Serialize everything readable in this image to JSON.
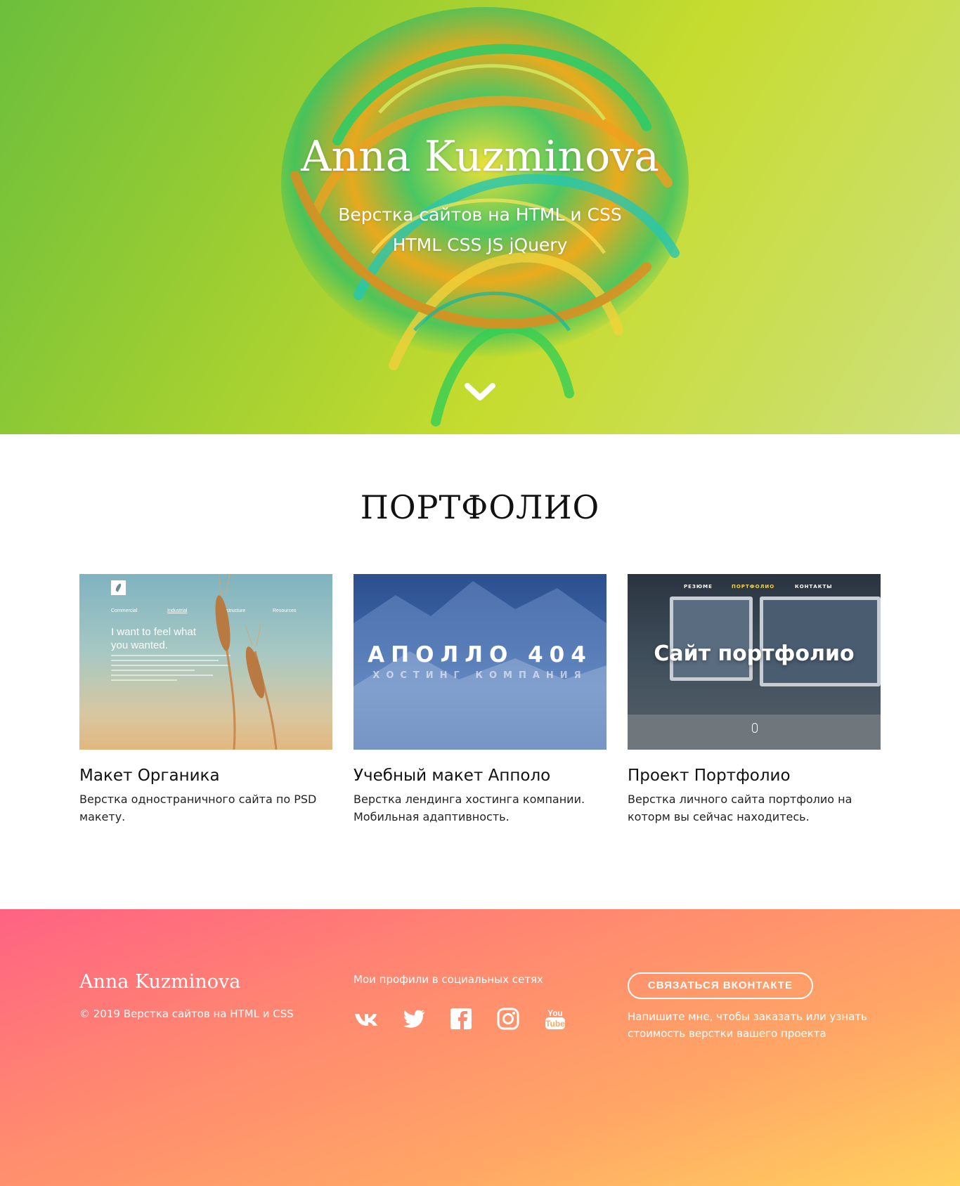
{
  "hero": {
    "title": "Anna Kuzminova",
    "subtitle_line1": "Верстка сайтов на HTML и CSS",
    "subtitle_line2": "HTML CSS JS jQuery",
    "scroll_icon": "chevron-down-icon"
  },
  "portfolio": {
    "heading": "ПОРТФОЛИО",
    "cards": [
      {
        "title": "Макет Органика",
        "description": "Верстка одностраничного сайта по PSD макету.",
        "thumb": {
          "nav": [
            "Commercial",
            "Industrial",
            "Infrastructure",
            "Resources"
          ],
          "tagline": "I want to feel what you wanted."
        }
      },
      {
        "title": "Учебный макет Апполо",
        "description": "Верстка лендинга хостинга компании. Мобильная адаптивность.",
        "thumb": {
          "headline": "АПОЛЛО 404",
          "subline": "ХОСТИНГ КОМПАНИЯ"
        }
      },
      {
        "title": "Проект Портфолио",
        "description": "Верстка личного сайта портфолио на которм вы сейчас находитесь.",
        "thumb": {
          "nav": [
            "РЕЗЮМЕ",
            "ПОРТФОЛИО",
            "КОНТАКТЫ"
          ],
          "headline": "Сайт портфолио"
        }
      }
    ]
  },
  "footer": {
    "name": "Anna Kuzminova",
    "copyright": "© 2019 Верстка сайтов на HTML и CSS",
    "social_title": "Мои профили в социальных сетях",
    "social_icons": [
      "vk-icon",
      "twitter-icon",
      "facebook-icon",
      "instagram-icon",
      "youtube-icon"
    ],
    "youtube_label_1": "You",
    "youtube_label_2": "Tube",
    "contact_button": "СВЯЗАТЬСЯ ВКОНТАКТЕ",
    "contact_note": "Напишите мне, чтобы заказать или узнать стоимость верстки вашего проекта"
  },
  "colors": {
    "hero_green": "#9acd32",
    "footer_pink": "#ff6283",
    "footer_yellow": "#ffd15e",
    "active_nav": "#f5d33a"
  }
}
